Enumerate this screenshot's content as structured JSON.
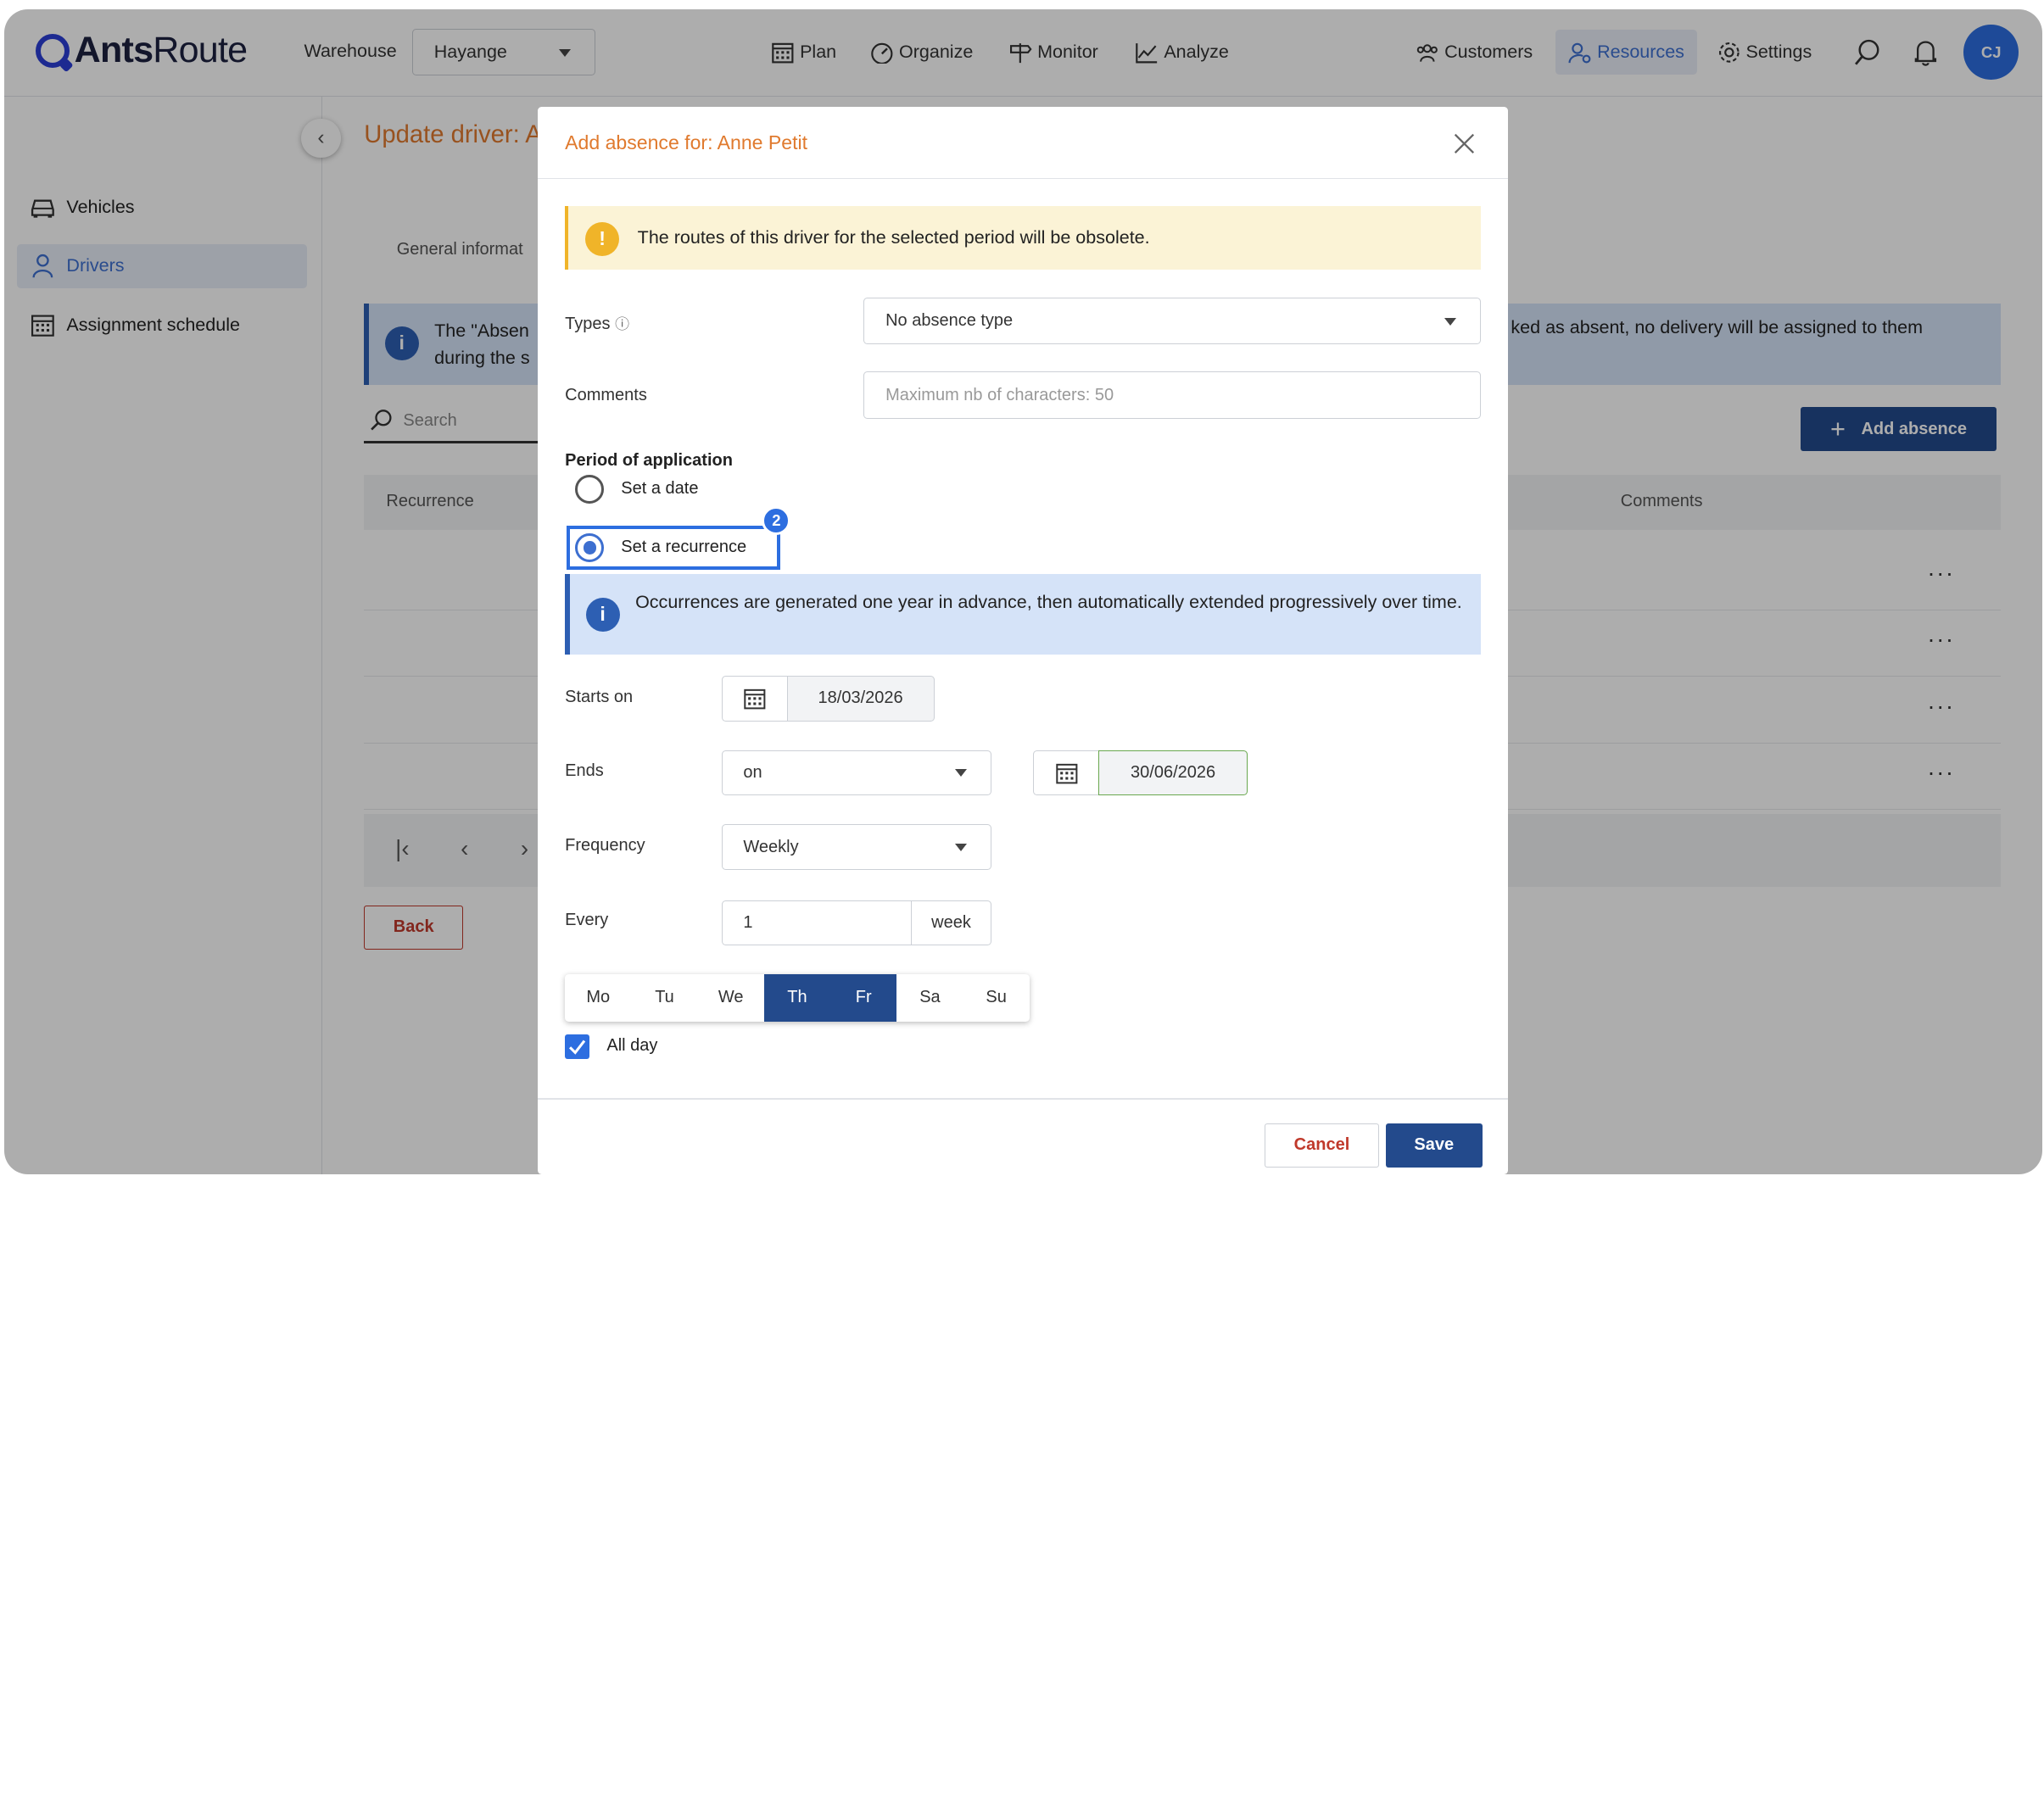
{
  "brand": {
    "name_part1": "Ants",
    "name_part2": "Route"
  },
  "topnav": {
    "warehouse_label": "Warehouse",
    "warehouse_value": "Hayange",
    "items": [
      {
        "label": "Plan",
        "icon": "calendar-icon"
      },
      {
        "label": "Organize",
        "icon": "gauge-icon"
      },
      {
        "label": "Monitor",
        "icon": "signpost-icon"
      },
      {
        "label": "Analyze",
        "icon": "chart-icon"
      }
    ],
    "right_items": [
      {
        "label": "Customers",
        "icon": "users-icon"
      },
      {
        "label": "Resources",
        "icon": "user-gear-icon"
      },
      {
        "label": "Settings",
        "icon": "gear-icon"
      }
    ],
    "avatar_initials": "CJ"
  },
  "sidebar": {
    "items": [
      {
        "label": "Vehicles",
        "icon": "car-icon"
      },
      {
        "label": "Drivers",
        "icon": "user-icon"
      },
      {
        "label": "Assignment schedule",
        "icon": "calendar-icon"
      }
    ]
  },
  "page": {
    "title": "Update driver: A",
    "tab_general": "General informat",
    "info_text_left": "The \"Absen during the s",
    "info_text_right": "ked as absent, no delivery will be assigned to them",
    "search_placeholder": "Search",
    "add_absence": "Add absence",
    "col_recurrence": "Recurrence",
    "col_comments": "Comments",
    "row_menu": "···",
    "back_label": "Back"
  },
  "modal": {
    "title": "Add absence for: Anne Petit",
    "warning": "The routes of this driver for the selected period will be obsolete.",
    "types_label": "Types",
    "types_value": "No absence type",
    "comments_label": "Comments",
    "comments_placeholder": "Maximum nb of characters: 50",
    "period_label": "Period of application",
    "opt_date": "Set a date",
    "opt_recurrence": "Set a recurrence",
    "step_badge": "2",
    "occ_info": "Occurrences are generated one year in advance, then automatically extended progressively over time.",
    "starts_label": "Starts on",
    "starts_value": "18/03/2026",
    "ends_label": "Ends",
    "ends_mode": "on",
    "ends_value": "30/06/2026",
    "freq_label": "Frequency",
    "freq_value": "Weekly",
    "every_label": "Every",
    "every_value": "1",
    "every_unit": "week",
    "days": [
      {
        "label": "Mo",
        "selected": false
      },
      {
        "label": "Tu",
        "selected": false
      },
      {
        "label": "We",
        "selected": false
      },
      {
        "label": "Th",
        "selected": true
      },
      {
        "label": "Fr",
        "selected": true
      },
      {
        "label": "Sa",
        "selected": false
      },
      {
        "label": "Su",
        "selected": false
      }
    ],
    "all_day_label": "All day",
    "all_day_checked": true,
    "cancel_label": "Cancel",
    "save_label": "Save"
  }
}
